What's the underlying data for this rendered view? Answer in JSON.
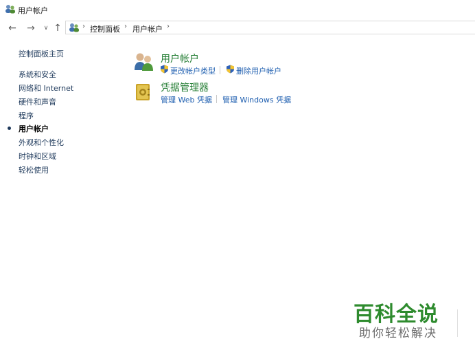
{
  "window": {
    "title": "用户帐户"
  },
  "nav": {
    "back_icon": "back-arrow-icon",
    "forward_icon": "forward-arrow-icon",
    "recent_icon": "chevron-down-icon",
    "up_icon": "up-arrow-icon"
  },
  "address": {
    "crumbs": [
      "控制面板",
      "用户帐户"
    ]
  },
  "sidebar": {
    "home": "控制面板主页",
    "items": [
      {
        "label": "系统和安全"
      },
      {
        "label": "网络和 Internet"
      },
      {
        "label": "硬件和声音"
      },
      {
        "label": "程序"
      },
      {
        "label": "用户帐户",
        "current": true
      },
      {
        "label": "外观和个性化"
      },
      {
        "label": "时钟和区域"
      },
      {
        "label": "轻松使用"
      }
    ]
  },
  "main": {
    "sections": [
      {
        "title": "用户帐户",
        "icon": "user-accounts-icon",
        "tasks": [
          {
            "label": "更改帐户类型",
            "shield": true
          },
          {
            "label": "删除用户帐户",
            "shield": true
          }
        ]
      },
      {
        "title": "凭据管理器",
        "icon": "credential-manager-icon",
        "tasks": [
          {
            "label": "管理 Web 凭据",
            "shield": false
          },
          {
            "label": "管理 Windows 凭据",
            "shield": false
          }
        ]
      }
    ]
  },
  "watermark": {
    "title": "百科全说",
    "subtitle": "助你轻松解决"
  },
  "colors": {
    "link": "#1f5fb0",
    "section_title": "#1e7a2e",
    "nav_link": "#1e395b",
    "watermark": "#2e8b2e"
  }
}
